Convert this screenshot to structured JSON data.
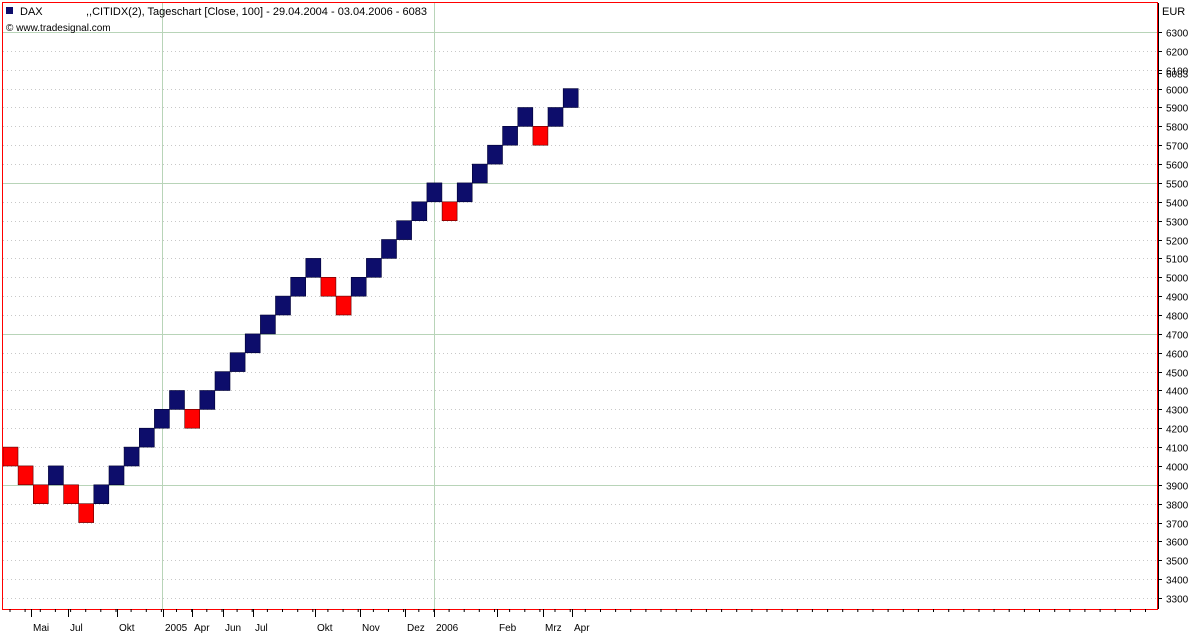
{
  "header": {
    "symbol": "DAX",
    "description": ",,CITIDX(2), Tageschart [Close, 100] - 29.04.2004 - 03.04.2006 - 6083",
    "copyright": "© www.tradesignal.com"
  },
  "colors": {
    "up_brick": "#0d0d6b",
    "down_brick": "#ff0000",
    "frame": "#ff0000",
    "gridline": "#b8d4b8",
    "dotted_grid": "#c8c8c8",
    "background": "#ffffff"
  },
  "chart_data": {
    "type": "renko",
    "box_size": 100,
    "unit": "EUR",
    "last_value": "6083",
    "ylim": [
      3250,
      6400
    ],
    "y_ticks": [
      "3300",
      "3400",
      "3500",
      "3600",
      "3700",
      "3800",
      "3900",
      "4000",
      "4100",
      "4200",
      "4300",
      "4400",
      "4500",
      "4600",
      "4700",
      "4800",
      "4900",
      "5000",
      "5100",
      "5200",
      "5300",
      "5400",
      "5500",
      "5600",
      "5700",
      "5800",
      "5900",
      "6000",
      "6083",
      "6100",
      "6200",
      "6300"
    ],
    "x_ticks": [
      "Mai",
      "Jul",
      "Okt",
      "2005",
      "Apr",
      "Jun",
      "Jul",
      "Okt",
      "Nov",
      "Dez",
      "2006",
      "Feb",
      "Mrz",
      "Apr"
    ],
    "bricks": [
      {
        "dir": "down",
        "low": 4000,
        "high": 4100
      },
      {
        "dir": "down",
        "low": 3900,
        "high": 4000
      },
      {
        "dir": "down",
        "low": 3800,
        "high": 3900
      },
      {
        "dir": "up",
        "low": 3900,
        "high": 4000
      },
      {
        "dir": "down",
        "low": 3800,
        "high": 3900
      },
      {
        "dir": "down",
        "low": 3700,
        "high": 3800
      },
      {
        "dir": "up",
        "low": 3800,
        "high": 3900
      },
      {
        "dir": "up",
        "low": 3900,
        "high": 4000
      },
      {
        "dir": "up",
        "low": 4000,
        "high": 4100
      },
      {
        "dir": "up",
        "low": 4100,
        "high": 4200
      },
      {
        "dir": "up",
        "low": 4200,
        "high": 4300
      },
      {
        "dir": "up",
        "low": 4300,
        "high": 4400
      },
      {
        "dir": "down",
        "low": 4200,
        "high": 4300
      },
      {
        "dir": "up",
        "low": 4300,
        "high": 4400
      },
      {
        "dir": "up",
        "low": 4400,
        "high": 4500
      },
      {
        "dir": "up",
        "low": 4500,
        "high": 4600
      },
      {
        "dir": "up",
        "low": 4600,
        "high": 4700
      },
      {
        "dir": "up",
        "low": 4700,
        "high": 4800
      },
      {
        "dir": "up",
        "low": 4800,
        "high": 4900
      },
      {
        "dir": "up",
        "low": 4900,
        "high": 5000
      },
      {
        "dir": "up",
        "low": 5000,
        "high": 5100
      },
      {
        "dir": "down",
        "low": 4900,
        "high": 5000
      },
      {
        "dir": "down",
        "low": 4800,
        "high": 4900
      },
      {
        "dir": "up",
        "low": 4900,
        "high": 5000
      },
      {
        "dir": "up",
        "low": 5000,
        "high": 5100
      },
      {
        "dir": "up",
        "low": 5100,
        "high": 5200
      },
      {
        "dir": "up",
        "low": 5200,
        "high": 5300
      },
      {
        "dir": "up",
        "low": 5300,
        "high": 5400
      },
      {
        "dir": "up",
        "low": 5400,
        "high": 5500
      },
      {
        "dir": "down",
        "low": 5300,
        "high": 5400
      },
      {
        "dir": "up",
        "low": 5400,
        "high": 5500
      },
      {
        "dir": "up",
        "low": 5500,
        "high": 5600
      },
      {
        "dir": "up",
        "low": 5600,
        "high": 5700
      },
      {
        "dir": "up",
        "low": 5700,
        "high": 5800
      },
      {
        "dir": "up",
        "low": 5800,
        "high": 5900
      },
      {
        "dir": "down",
        "low": 5700,
        "high": 5800
      },
      {
        "dir": "up",
        "low": 5800,
        "high": 5900
      },
      {
        "dir": "up",
        "low": 5900,
        "high": 6000
      }
    ]
  }
}
